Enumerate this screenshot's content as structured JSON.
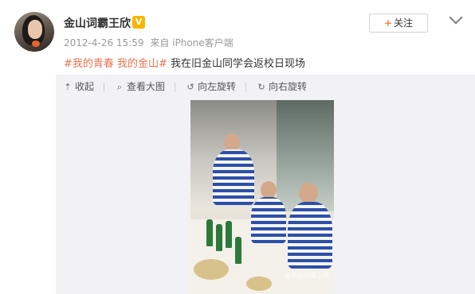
{
  "user": {
    "name": "金山词霸王欣",
    "verified_badge": "V"
  },
  "meta": {
    "date": "2012-4-26 15:59",
    "source": "来自 iPhone客户端"
  },
  "follow_button": {
    "plus": "+",
    "label": "关注"
  },
  "post": {
    "hashtag": "#我的青春 我的金山#",
    "text": " 我在旧金山同学会返校日现场"
  },
  "toolbar": {
    "collapse": "收起",
    "view_large": "查看大图",
    "rotate_left": "向左旋转",
    "rotate_right": "向右旋转"
  },
  "photo": {
    "watermark": "@金山词霸王欣"
  },
  "colors": {
    "accent": "#eb7350",
    "badge": "#f7b500",
    "media_bg": "#f2f2f5"
  },
  "icons": [
    "avatar",
    "verified-icon",
    "chevron-down-icon",
    "collapse-icon",
    "search-icon",
    "rotate-left-icon",
    "rotate-right-icon"
  ]
}
